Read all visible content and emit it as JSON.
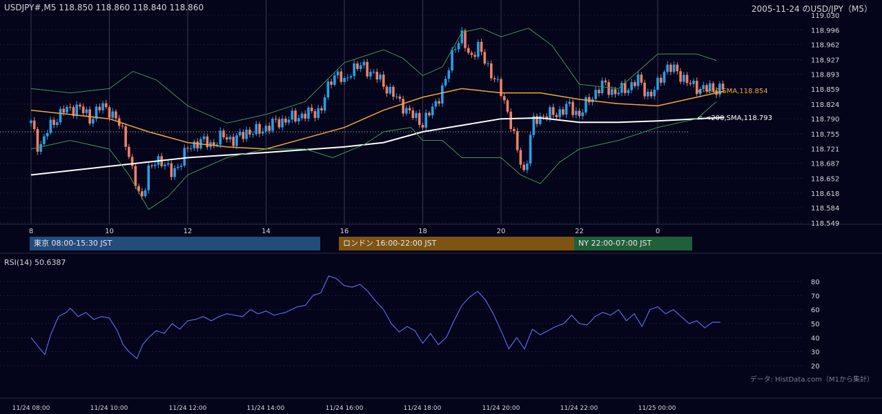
{
  "header": {
    "symbol_info": "USDJPY#,M5 118.850 118.860 118.840 118.860",
    "title": "2005-11-24 のUSD/JPY（M5）"
  },
  "rsi_label": "RSI(14) 50.6387",
  "source_note": "データ: HistData.com（M1から集計）",
  "sessions": [
    {
      "label": "東京 08:00-15:30 JST",
      "color": "#234b7c"
    },
    {
      "label": "ロンドン 16:00-22:00 JST",
      "color": "#7d5412"
    },
    {
      "label": "NY 22:00-07:00 JST",
      "color": "#1f5f3a"
    }
  ],
  "annotations": {
    "sma40": "<-<40,SMA,118.854",
    "sma200": "<-<200,SMA,118.793"
  },
  "colors": {
    "background": "#04041a",
    "bull": "#27a0e6",
    "bear": "#ef7f68",
    "sma40": "#f4a73c",
    "sma200": "#ffffff",
    "bollinger": "#3a9a52",
    "rsi": "#5b68e8"
  },
  "chart_data": [
    {
      "type": "candlestick",
      "title": "2005-11-24 のUSD/JPY（M5）",
      "y_ticks": [
        "119.030",
        "118.996",
        "118.962",
        "118.927",
        "118.893",
        "118.859",
        "118.824",
        "118.790",
        "118.755",
        "118.721",
        "118.687",
        "118.652",
        "118.618",
        "118.584",
        "118.549"
      ],
      "ylim": [
        118.549,
        119.03
      ],
      "x_ticks": [
        "8",
        "10",
        "12",
        "14",
        "16",
        "18",
        "20",
        "22",
        "0"
      ],
      "reference_line": 118.76,
      "price_path": [
        [
          0,
          118.78
        ],
        [
          0.2,
          118.72
        ],
        [
          0.4,
          118.76
        ],
        [
          0.8,
          118.81
        ],
        [
          1.0,
          118.81
        ],
        [
          1.2,
          118.82
        ],
        [
          1.5,
          118.79
        ],
        [
          1.8,
          118.82
        ],
        [
          2.0,
          118.81
        ],
        [
          2.3,
          118.77
        ],
        [
          2.45,
          118.73
        ],
        [
          2.6,
          118.66
        ],
        [
          2.8,
          118.6
        ],
        [
          3.0,
          118.67
        ],
        [
          3.3,
          118.7
        ],
        [
          3.6,
          118.66
        ],
        [
          3.8,
          118.69
        ],
        [
          4.0,
          118.72
        ],
        [
          4.3,
          118.74
        ],
        [
          4.6,
          118.73
        ],
        [
          4.9,
          118.75
        ],
        [
          5.2,
          118.74
        ],
        [
          5.5,
          118.76
        ],
        [
          5.8,
          118.76
        ],
        [
          6.2,
          118.78
        ],
        [
          6.6,
          118.79
        ],
        [
          7.0,
          118.8
        ],
        [
          7.4,
          118.81
        ],
        [
          7.65,
          118.88
        ],
        [
          7.8,
          118.9
        ],
        [
          8.0,
          118.87
        ],
        [
          8.2,
          118.91
        ],
        [
          8.5,
          118.91
        ],
        [
          8.8,
          118.89
        ],
        [
          9.1,
          118.86
        ],
        [
          9.4,
          118.83
        ],
        [
          9.7,
          118.8
        ],
        [
          10.0,
          118.78
        ],
        [
          10.3,
          118.82
        ],
        [
          10.6,
          118.88
        ],
        [
          10.8,
          118.96
        ],
        [
          11.0,
          118.98
        ],
        [
          11.2,
          118.93
        ],
        [
          11.4,
          118.96
        ],
        [
          11.6,
          118.92
        ],
        [
          11.8,
          118.89
        ],
        [
          12.0,
          118.85
        ],
        [
          12.2,
          118.8
        ],
        [
          12.4,
          118.72
        ],
        [
          12.6,
          118.66
        ],
        [
          12.8,
          118.78
        ],
        [
          13.1,
          118.8
        ],
        [
          13.4,
          118.8
        ],
        [
          13.7,
          118.82
        ],
        [
          14.0,
          118.8
        ],
        [
          14.3,
          118.84
        ],
        [
          14.6,
          118.87
        ],
        [
          14.9,
          118.85
        ],
        [
          15.2,
          118.86
        ],
        [
          15.5,
          118.88
        ],
        [
          15.8,
          118.84
        ],
        [
          16.0,
          118.87
        ],
        [
          16.2,
          118.91
        ],
        [
          16.5,
          118.9
        ],
        [
          16.8,
          118.87
        ],
        [
          17.1,
          118.86
        ],
        [
          17.4,
          118.86
        ],
        [
          17.7,
          118.86
        ]
      ],
      "series": [
        {
          "name": "40,SMA",
          "last": 118.854,
          "path": [
            [
              0,
              118.81
            ],
            [
              1,
              118.8
            ],
            [
              2,
              118.79
            ],
            [
              3,
              118.76
            ],
            [
              4,
              118.735
            ],
            [
              5,
              118.725
            ],
            [
              6,
              118.72
            ],
            [
              7,
              118.745
            ],
            [
              8,
              118.77
            ],
            [
              9,
              118.81
            ],
            [
              10,
              118.84
            ],
            [
              11,
              118.86
            ],
            [
              12,
              118.85
            ],
            [
              13,
              118.85
            ],
            [
              14,
              118.835
            ],
            [
              15,
              118.825
            ],
            [
              16,
              118.82
            ],
            [
              17,
              118.84
            ],
            [
              17.7,
              118.854
            ]
          ]
        },
        {
          "name": "200,SMA",
          "last": 118.793,
          "path": [
            [
              0,
              118.66
            ],
            [
              2,
              118.68
            ],
            [
              4,
              118.7
            ],
            [
              6,
              118.712
            ],
            [
              8,
              118.725
            ],
            [
              9,
              118.735
            ],
            [
              10,
              118.76
            ],
            [
              11,
              118.775
            ],
            [
              12,
              118.79
            ],
            [
              13,
              118.792
            ],
            [
              14,
              118.782
            ],
            [
              15,
              118.782
            ],
            [
              16,
              118.785
            ],
            [
              17,
              118.79
            ],
            [
              17.7,
              118.793
            ]
          ]
        },
        {
          "name": "Bollinger upper",
          "path": [
            [
              0,
              118.86
            ],
            [
              1,
              118.85
            ],
            [
              2,
              118.86
            ],
            [
              2.6,
              118.9
            ],
            [
              3.2,
              118.88
            ],
            [
              4,
              118.82
            ],
            [
              5,
              118.78
            ],
            [
              6,
              118.8
            ],
            [
              7,
              118.83
            ],
            [
              8,
              118.92
            ],
            [
              9,
              118.95
            ],
            [
              9.5,
              118.93
            ],
            [
              10,
              118.89
            ],
            [
              10.5,
              118.91
            ],
            [
              11,
              118.99
            ],
            [
              11.5,
              119.0
            ],
            [
              12,
              118.98
            ],
            [
              12.7,
              119.0
            ],
            [
              13.3,
              118.96
            ],
            [
              14,
              118.87
            ],
            [
              15,
              118.86
            ],
            [
              16,
              118.94
            ],
            [
              17,
              118.94
            ],
            [
              17.5,
              118.925
            ]
          ]
        },
        {
          "name": "Bollinger lower",
          "path": [
            [
              0,
              118.72
            ],
            [
              1,
              118.74
            ],
            [
              2,
              118.72
            ],
            [
              2.5,
              118.66
            ],
            [
              3,
              118.58
            ],
            [
              3.5,
              118.61
            ],
            [
              4,
              118.66
            ],
            [
              5,
              118.7
            ],
            [
              6,
              118.72
            ],
            [
              7,
              118.72
            ],
            [
              7.7,
              118.7
            ],
            [
              8.5,
              118.73
            ],
            [
              9,
              118.76
            ],
            [
              9.7,
              118.77
            ],
            [
              10,
              118.74
            ],
            [
              10.5,
              118.74
            ],
            [
              11,
              118.7
            ],
            [
              12,
              118.7
            ],
            [
              12.5,
              118.66
            ],
            [
              13,
              118.64
            ],
            [
              13.5,
              118.69
            ],
            [
              14,
              118.72
            ],
            [
              15,
              118.74
            ],
            [
              16,
              118.77
            ],
            [
              17,
              118.79
            ],
            [
              17.5,
              118.83
            ]
          ]
        }
      ]
    },
    {
      "type": "line",
      "title": "RSI(14)",
      "y_ticks": [
        80,
        70,
        60,
        50,
        40,
        30,
        20
      ],
      "ylim": [
        15,
        87
      ],
      "x_ticks": [
        "11/24 08:00",
        "11/24 10:00",
        "11/24 12:00",
        "11/24 14:00",
        "11/24 16:00",
        "11/24 18:00",
        "11/24 20:00",
        "11/24 22:00",
        "11/25 00:00"
      ],
      "series": [
        {
          "name": "RSI(14)",
          "last": 50.6387,
          "path": [
            [
              0,
              40
            ],
            [
              0.2,
              33
            ],
            [
              0.35,
              28
            ],
            [
              0.5,
              42
            ],
            [
              0.7,
              55
            ],
            [
              0.9,
              58
            ],
            [
              1.0,
              61
            ],
            [
              1.2,
              55
            ],
            [
              1.4,
              58
            ],
            [
              1.6,
              53
            ],
            [
              1.8,
              55
            ],
            [
              2.0,
              54
            ],
            [
              2.2,
              45
            ],
            [
              2.35,
              35
            ],
            [
              2.5,
              30
            ],
            [
              2.7,
              25
            ],
            [
              2.85,
              35
            ],
            [
              3.0,
              40
            ],
            [
              3.2,
              45
            ],
            [
              3.4,
              43
            ],
            [
              3.6,
              50
            ],
            [
              3.8,
              46
            ],
            [
              4.0,
              52
            ],
            [
              4.2,
              53
            ],
            [
              4.4,
              55
            ],
            [
              4.6,
              52
            ],
            [
              4.8,
              55
            ],
            [
              5.0,
              57
            ],
            [
              5.2,
              56
            ],
            [
              5.4,
              55
            ],
            [
              5.6,
              60
            ],
            [
              5.8,
              57
            ],
            [
              6.0,
              59
            ],
            [
              6.2,
              56
            ],
            [
              6.5,
              58
            ],
            [
              6.8,
              62
            ],
            [
              7.0,
              63
            ],
            [
              7.2,
              70
            ],
            [
              7.4,
              72
            ],
            [
              7.6,
              84
            ],
            [
              7.8,
              82
            ],
            [
              8.0,
              77
            ],
            [
              8.2,
              76
            ],
            [
              8.4,
              78
            ],
            [
              8.6,
              73
            ],
            [
              8.8,
              66
            ],
            [
              9.0,
              60
            ],
            [
              9.2,
              50
            ],
            [
              9.4,
              44
            ],
            [
              9.6,
              48
            ],
            [
              9.8,
              45
            ],
            [
              10.0,
              36
            ],
            [
              10.2,
              43
            ],
            [
              10.4,
              35
            ],
            [
              10.6,
              40
            ],
            [
              10.8,
              52
            ],
            [
              11.0,
              63
            ],
            [
              11.2,
              69
            ],
            [
              11.4,
              73
            ],
            [
              11.6,
              67
            ],
            [
              11.8,
              57
            ],
            [
              12.0,
              45
            ],
            [
              12.2,
              32
            ],
            [
              12.4,
              40
            ],
            [
              12.6,
              32
            ],
            [
              12.8,
              46
            ],
            [
              13.0,
              42
            ],
            [
              13.2,
              45
            ],
            [
              13.4,
              48
            ],
            [
              13.6,
              50
            ],
            [
              13.8,
              56
            ],
            [
              14.0,
              50
            ],
            [
              14.2,
              49
            ],
            [
              14.4,
              55
            ],
            [
              14.6,
              58
            ],
            [
              14.8,
              56
            ],
            [
              15.0,
              60
            ],
            [
              15.2,
              52
            ],
            [
              15.4,
              57
            ],
            [
              15.6,
              48
            ],
            [
              15.8,
              60
            ],
            [
              16.0,
              62
            ],
            [
              16.2,
              57
            ],
            [
              16.4,
              60
            ],
            [
              16.6,
              55
            ],
            [
              16.8,
              50
            ],
            [
              17.0,
              52
            ],
            [
              17.2,
              47
            ],
            [
              17.4,
              51
            ],
            [
              17.6,
              51
            ]
          ]
        }
      ]
    }
  ]
}
